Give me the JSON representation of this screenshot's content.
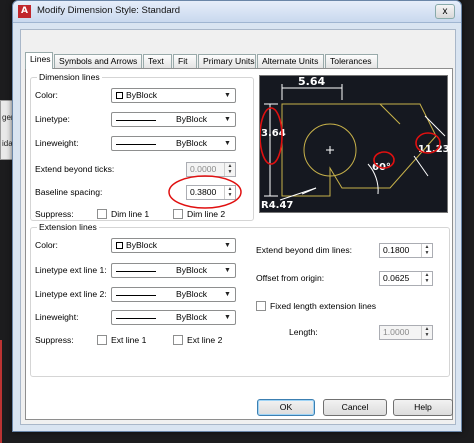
{
  "window": {
    "title": "Modify Dimension Style: Standard",
    "app_icon": "A",
    "close_label": "x"
  },
  "background": {
    "panel_lines": [
      "ger",
      "idar"
    ]
  },
  "tabs": [
    "Lines",
    "Symbols and Arrows",
    "Text",
    "Fit",
    "Primary Units",
    "Alternate Units",
    "Tolerances"
  ],
  "dimension_lines": {
    "group_label": "Dimension lines",
    "color_label": "Color:",
    "color_value": "ByBlock",
    "linetype_label": "Linetype:",
    "linetype_value": "ByBlock",
    "lineweight_label": "Lineweight:",
    "lineweight_value": "ByBlock",
    "extend_label": "Extend beyond ticks:",
    "extend_value": "0.0000",
    "baseline_label": "Baseline spacing:",
    "baseline_value": "0.3800",
    "suppress_label": "Suppress:",
    "dim1_label": "Dim line 1",
    "dim2_label": "Dim line 2"
  },
  "extension_lines": {
    "group_label": "Extension lines",
    "color_label": "Color:",
    "color_value": "ByBlock",
    "lt1_label": "Linetype ext line 1:",
    "lt1_value": "ByBlock",
    "lt2_label": "Linetype ext line 2:",
    "lt2_value": "ByBlock",
    "lineweight_label": "Lineweight:",
    "lineweight_value": "ByBlock",
    "suppress_label": "Suppress:",
    "ext1_label": "Ext line 1",
    "ext2_label": "Ext line 2",
    "extend_dim_label": "Extend beyond dim lines:",
    "extend_dim_value": "0.1800",
    "offset_label": "Offset from origin:",
    "offset_value": "0.0625",
    "fixed_label": "Fixed length extension lines",
    "length_label": "Length:",
    "length_value": "1.0000"
  },
  "preview": {
    "dim_top": "5.64",
    "dim_left": "3.64",
    "dim_right": "11.23",
    "dim_angle": "60°",
    "dim_radius": "R4.47"
  },
  "buttons": {
    "ok": "OK",
    "cancel": "Cancel",
    "help": "Help"
  },
  "colors": {
    "annotation": "#e01010",
    "preview_bg": "#151820",
    "geometry": "#c8b24a"
  }
}
